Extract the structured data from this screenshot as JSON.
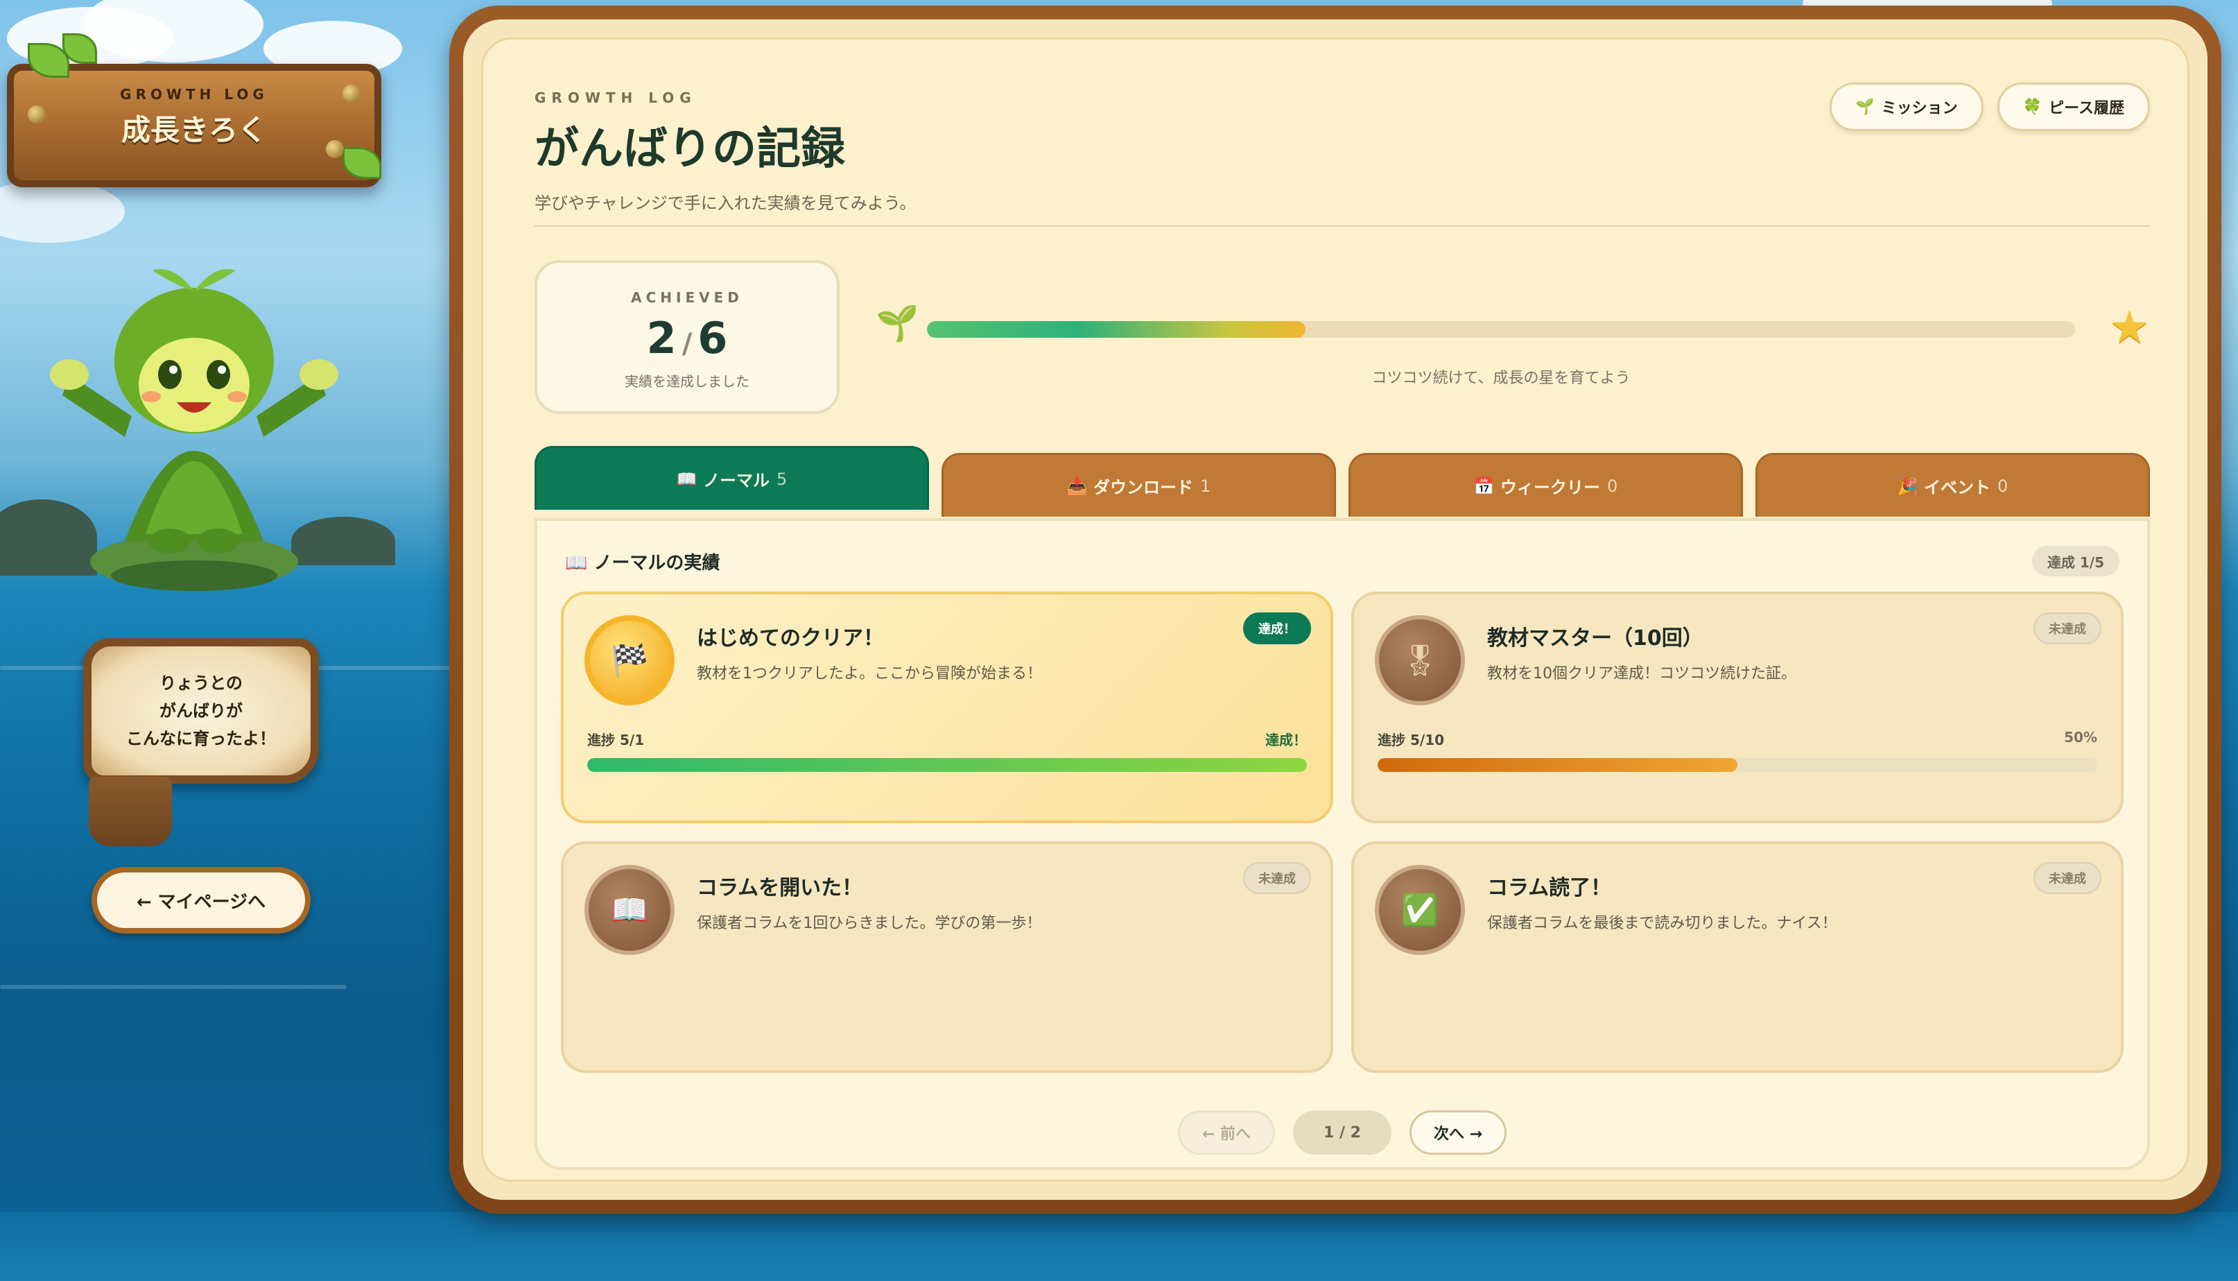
{
  "sign": {
    "eyebrow": "GROWTH LOG",
    "title": "成長きろく"
  },
  "speech": {
    "line1": "りょうとの",
    "line2": "がんばりが",
    "line3": "こんなに育ったよ！"
  },
  "back_button": "← マイページへ",
  "header": {
    "eyebrow": "GROWTH LOG",
    "title": "がんばりの記録",
    "subtitle": "学びやチャレンジで手に入れた実績を見てみよう。"
  },
  "top_buttons": [
    {
      "icon": "sprout-icon",
      "glyph": "🌱",
      "label": "ミッション"
    },
    {
      "icon": "clover-icon",
      "glyph": "🍀",
      "label": "ピース履歴"
    }
  ],
  "stats": {
    "label": "ACHIEVED",
    "achieved": "2",
    "sep": "/",
    "total": "6",
    "desc": "実績を達成しました"
  },
  "overall_progress": {
    "fraction": 0.33,
    "caption": "コツコツ続けて、成長の星を育てよう"
  },
  "tabs": [
    {
      "icon": "📖",
      "label": "ノーマル",
      "count": "5",
      "active": true
    },
    {
      "icon": "📥",
      "label": "ダウンロード",
      "count": "1",
      "active": false
    },
    {
      "icon": "📅",
      "label": "ウィークリー",
      "count": "0",
      "active": false
    },
    {
      "icon": "🎉",
      "label": "イベント",
      "count": "0",
      "active": false
    }
  ],
  "section": {
    "title": "📖 ノーマルの実績",
    "badge": "達成 1/5"
  },
  "cards": [
    {
      "title": "はじめてのクリア！",
      "desc": "教材を1つクリアしたよ。ここから冒険が始まる！",
      "status": "達成！",
      "done": true,
      "icon": "🏁",
      "icon_name": "checkered-flag-icon",
      "progress_label": "進捗",
      "progress_value": "5/1",
      "progress_right": "達成！",
      "progress": 1.0
    },
    {
      "title": "教材マスター（10回）",
      "desc": "教材を10個クリア達成！コツコツ続けた証。",
      "status": "未達成",
      "done": false,
      "icon": "🎖",
      "icon_name": "medal-icon",
      "progress_label": "進捗",
      "progress_value": "5/10",
      "progress_right": "50%",
      "progress": 0.5
    },
    {
      "title": "コラムを開いた！",
      "desc": "保護者コラムを1回ひらきました。学びの第一歩！",
      "status": "未達成",
      "done": false,
      "icon": "📖",
      "icon_name": "book-icon"
    },
    {
      "title": "コラム読了！",
      "desc": "保護者コラムを最後まで読み切りました。ナイス！",
      "status": "未達成",
      "done": false,
      "icon": "✅",
      "icon_name": "check-icon"
    }
  ],
  "pager": {
    "prev": "← 前へ",
    "current": "1 / 2",
    "next": "次へ →"
  },
  "colors": {
    "accent": "#0d7a57",
    "tab": "#c07a35",
    "frame": "#8a4e1f",
    "gold": "#f5b52a"
  }
}
